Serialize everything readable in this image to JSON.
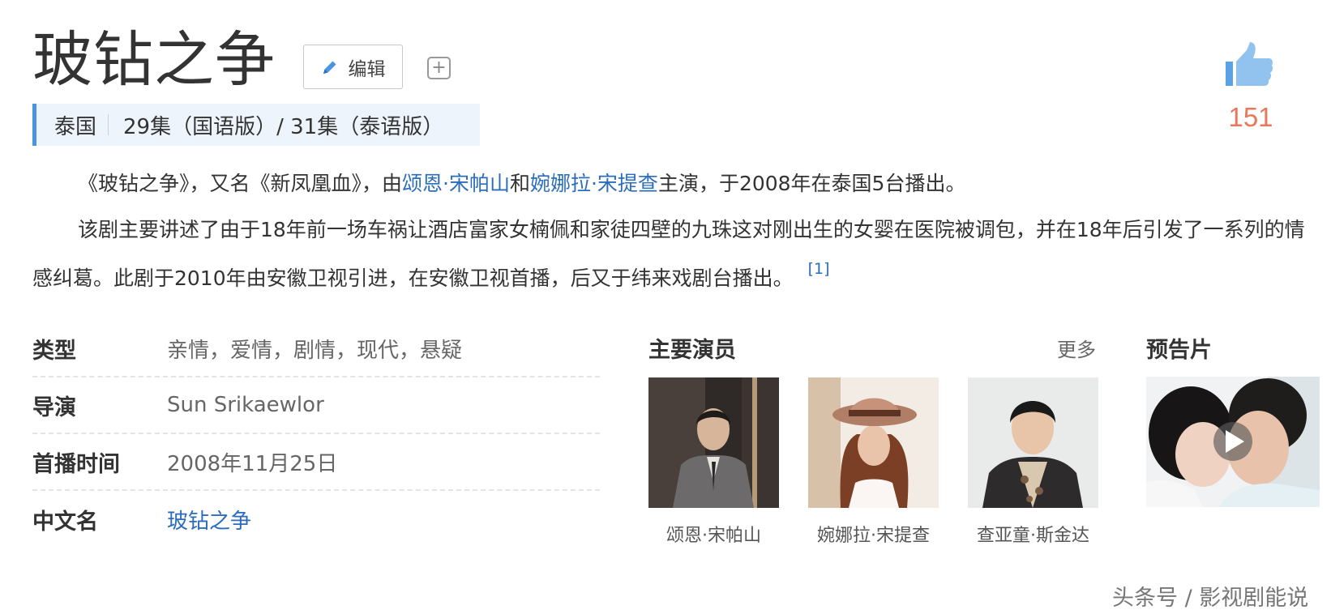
{
  "header": {
    "title": "玻钻之争",
    "edit_label": "编辑",
    "add_icon": "plus-square-icon",
    "like_icon": "thumbs-up-icon",
    "like_count": "151"
  },
  "meta": {
    "country": "泰国",
    "episodes": "29集（国语版）/ 31集（泰语版）"
  },
  "summary": {
    "p1_prefix": "《玻钻之争》，又名《新凤凰血》，由",
    "p1_link1": "颂恩·宋帕山",
    "p1_mid": "和",
    "p1_link2": "婉娜拉·宋提查",
    "p1_suffix": "主演，于2008年在泰国5台播出。",
    "p2_text": "该剧主要讲述了由于18年前一场车祸让酒店富家女楠佩和家徒四壁的九珠这对刚出生的女婴在医院被调包，并在18年后引发了一系列的情感纠葛。此剧于2010年由安徽卫视引进，在安徽卫视首播，后又于纬来戏剧台播出。",
    "citation": "[1]"
  },
  "info": [
    {
      "label": "类型",
      "value": "亲情，爱情，剧情，现代，悬疑"
    },
    {
      "label": "导演",
      "value": "Sun Srikaewlor"
    },
    {
      "label": "首播时间",
      "value": "2008年11月25日"
    },
    {
      "label": "中文名",
      "value": "玻钻之争"
    }
  ],
  "cast": {
    "heading": "主要演员",
    "more": "更多",
    "members": [
      {
        "name": "颂恩·宋帕山"
      },
      {
        "name": "婉娜拉·宋提查"
      },
      {
        "name": "查亚童·斯金达"
      }
    ]
  },
  "trailer": {
    "heading": "预告片",
    "play_icon": "play-icon"
  },
  "watermark": "头条号 / 影视剧能说",
  "colors": {
    "link": "#2b6dbd",
    "accent_bar": "#4b94e2",
    "like_icon": "#79b4ea",
    "like_count": "#e8775c"
  }
}
